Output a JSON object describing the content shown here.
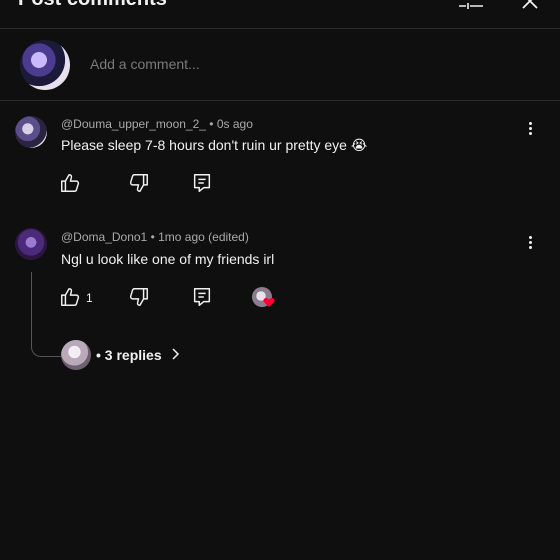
{
  "header": {
    "title": "Post comments",
    "title_chevron": "›"
  },
  "composer": {
    "placeholder": "Add a comment..."
  },
  "comments": [
    {
      "author": "@Douma_upper_moon_2_",
      "time": "0s ago",
      "text": "Please sleep 7-8 hours don't ruin ur pretty eye 😭",
      "likes": ""
    },
    {
      "author": "@Doma_Dono1",
      "time": "1mo ago (edited)",
      "text": "Ngl u look like one of my friends irl",
      "likes": "1"
    }
  ],
  "thread": {
    "replies_label": "3 replies"
  },
  "icons": {
    "like": "thumbs-up-icon",
    "dislike": "thumbs-down-icon",
    "reply": "reply-icon",
    "more": "more-vert-icon",
    "filter": "filter-icon",
    "close": "close-icon",
    "creator_heart": "creator-heart-icon"
  },
  "colors": {
    "background": "#0f0f0f",
    "text_primary": "#f1f1f1",
    "text_secondary": "#aaaaaa",
    "heart": "#ff0033"
  }
}
